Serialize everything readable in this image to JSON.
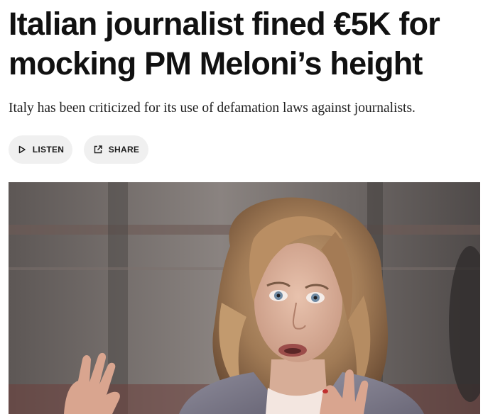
{
  "article": {
    "headline_line1": "Italian journalist fined €5K for",
    "headline_line2": "mocking PM Meloni’s height",
    "dek": "Italy has been criticized for its use of defamation laws against journalists."
  },
  "actions": {
    "listen_label": "LISTEN",
    "listen_icon": "play-icon",
    "share_label": "SHARE",
    "share_icon": "share-external-icon"
  },
  "photo": {
    "subject": "woman-speaking-gesturing-portrait"
  },
  "colors": {
    "text": "#111111",
    "pill_bg": "#f0f0f0",
    "background": "#ffffff"
  }
}
